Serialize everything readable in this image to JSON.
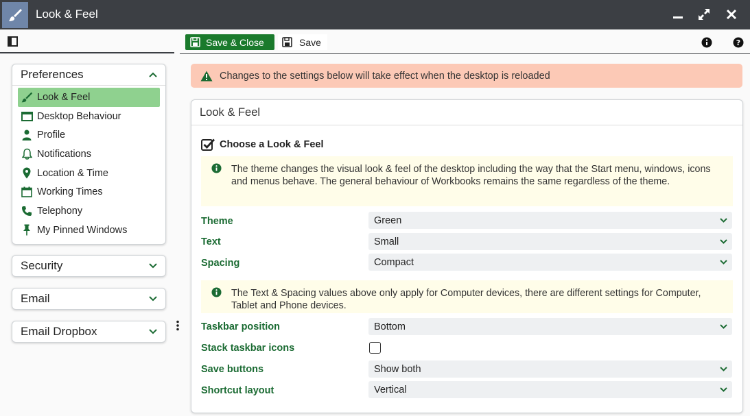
{
  "window": {
    "title": "Look & Feel",
    "icon": "paintbrush-icon",
    "controls": [
      "minimize-icon",
      "maximize-icon",
      "close-icon"
    ]
  },
  "toolbar": {
    "save_close_label": "Save & Close",
    "save_label": "Save",
    "right_icons": [
      "info-icon",
      "help-icon"
    ]
  },
  "sidebar": {
    "sections": [
      {
        "label": "Preferences",
        "expanded": true,
        "items": [
          {
            "label": "Look & Feel",
            "icon": "paintbrush-icon",
            "active": true
          },
          {
            "label": "Desktop Behaviour",
            "icon": "window-icon"
          },
          {
            "label": "Profile",
            "icon": "person-icon"
          },
          {
            "label": "Notifications",
            "icon": "bell-icon"
          },
          {
            "label": "Location & Time",
            "icon": "map-pin-icon"
          },
          {
            "label": "Working Times",
            "icon": "calendar-icon"
          },
          {
            "label": "Telephony",
            "icon": "phone-icon"
          },
          {
            "label": "My Pinned Windows",
            "icon": "pin-icon"
          }
        ]
      },
      {
        "label": "Security",
        "expanded": false
      },
      {
        "label": "Email",
        "expanded": false
      },
      {
        "label": "Email Dropbox",
        "expanded": false
      }
    ]
  },
  "main": {
    "alert": "Changes to the settings below will take effect when the desktop is reloaded",
    "panel_title": "Look & Feel",
    "section_title": "Choose a Look & Feel",
    "info1": "The theme changes the visual look & feel of the desktop including the way that the Start menu, windows, icons and menus behave. The general behaviour of Workbooks remains the same regardless of the theme.",
    "info2": "The Text & Spacing values above only apply for Computer devices, there are different settings for Computer, Tablet and Phone devices.",
    "fields": {
      "theme": {
        "label": "Theme",
        "value": "Green"
      },
      "text": {
        "label": "Text",
        "value": "Small"
      },
      "spacing": {
        "label": "Spacing",
        "value": "Compact"
      },
      "taskbar_position": {
        "label": "Taskbar position",
        "value": "Bottom"
      },
      "stack_taskbar_icons": {
        "label": "Stack taskbar icons",
        "checked": false
      },
      "save_buttons": {
        "label": "Save buttons",
        "value": "Show both"
      },
      "shortcut_layout": {
        "label": "Shortcut layout",
        "value": "Vertical"
      }
    }
  },
  "colors": {
    "titlebar": "#3c3f44",
    "accent_green": "#1a7a2c",
    "active_item": "#8fd18f",
    "label_green": "#1b6b33",
    "alert_bg": "#fcc9b6",
    "info_bg": "#fffde9"
  }
}
